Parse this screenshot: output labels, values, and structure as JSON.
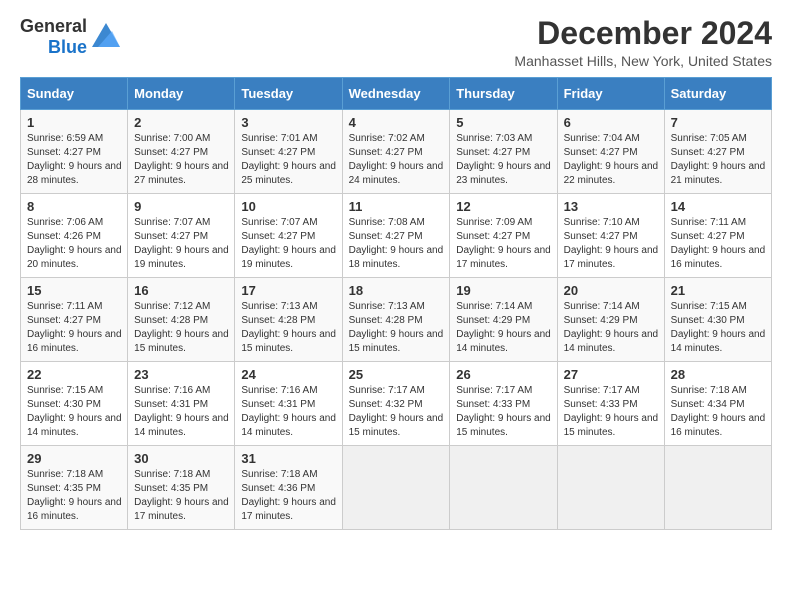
{
  "header": {
    "logo_general": "General",
    "logo_blue": "Blue",
    "month_title": "December 2024",
    "location": "Manhasset Hills, New York, United States"
  },
  "weekdays": [
    "Sunday",
    "Monday",
    "Tuesday",
    "Wednesday",
    "Thursday",
    "Friday",
    "Saturday"
  ],
  "weeks": [
    [
      {
        "day": "1",
        "sunrise": "6:59 AM",
        "sunset": "4:27 PM",
        "daylight": "9 hours and 28 minutes."
      },
      {
        "day": "2",
        "sunrise": "7:00 AM",
        "sunset": "4:27 PM",
        "daylight": "9 hours and 27 minutes."
      },
      {
        "day": "3",
        "sunrise": "7:01 AM",
        "sunset": "4:27 PM",
        "daylight": "9 hours and 25 minutes."
      },
      {
        "day": "4",
        "sunrise": "7:02 AM",
        "sunset": "4:27 PM",
        "daylight": "9 hours and 24 minutes."
      },
      {
        "day": "5",
        "sunrise": "7:03 AM",
        "sunset": "4:27 PM",
        "daylight": "9 hours and 23 minutes."
      },
      {
        "day": "6",
        "sunrise": "7:04 AM",
        "sunset": "4:27 PM",
        "daylight": "9 hours and 22 minutes."
      },
      {
        "day": "7",
        "sunrise": "7:05 AM",
        "sunset": "4:27 PM",
        "daylight": "9 hours and 21 minutes."
      }
    ],
    [
      {
        "day": "8",
        "sunrise": "7:06 AM",
        "sunset": "4:26 PM",
        "daylight": "9 hours and 20 minutes."
      },
      {
        "day": "9",
        "sunrise": "7:07 AM",
        "sunset": "4:27 PM",
        "daylight": "9 hours and 19 minutes."
      },
      {
        "day": "10",
        "sunrise": "7:07 AM",
        "sunset": "4:27 PM",
        "daylight": "9 hours and 19 minutes."
      },
      {
        "day": "11",
        "sunrise": "7:08 AM",
        "sunset": "4:27 PM",
        "daylight": "9 hours and 18 minutes."
      },
      {
        "day": "12",
        "sunrise": "7:09 AM",
        "sunset": "4:27 PM",
        "daylight": "9 hours and 17 minutes."
      },
      {
        "day": "13",
        "sunrise": "7:10 AM",
        "sunset": "4:27 PM",
        "daylight": "9 hours and 17 minutes."
      },
      {
        "day": "14",
        "sunrise": "7:11 AM",
        "sunset": "4:27 PM",
        "daylight": "9 hours and 16 minutes."
      }
    ],
    [
      {
        "day": "15",
        "sunrise": "7:11 AM",
        "sunset": "4:27 PM",
        "daylight": "9 hours and 16 minutes."
      },
      {
        "day": "16",
        "sunrise": "7:12 AM",
        "sunset": "4:28 PM",
        "daylight": "9 hours and 15 minutes."
      },
      {
        "day": "17",
        "sunrise": "7:13 AM",
        "sunset": "4:28 PM",
        "daylight": "9 hours and 15 minutes."
      },
      {
        "day": "18",
        "sunrise": "7:13 AM",
        "sunset": "4:28 PM",
        "daylight": "9 hours and 15 minutes."
      },
      {
        "day": "19",
        "sunrise": "7:14 AM",
        "sunset": "4:29 PM",
        "daylight": "9 hours and 14 minutes."
      },
      {
        "day": "20",
        "sunrise": "7:14 AM",
        "sunset": "4:29 PM",
        "daylight": "9 hours and 14 minutes."
      },
      {
        "day": "21",
        "sunrise": "7:15 AM",
        "sunset": "4:30 PM",
        "daylight": "9 hours and 14 minutes."
      }
    ],
    [
      {
        "day": "22",
        "sunrise": "7:15 AM",
        "sunset": "4:30 PM",
        "daylight": "9 hours and 14 minutes."
      },
      {
        "day": "23",
        "sunrise": "7:16 AM",
        "sunset": "4:31 PM",
        "daylight": "9 hours and 14 minutes."
      },
      {
        "day": "24",
        "sunrise": "7:16 AM",
        "sunset": "4:31 PM",
        "daylight": "9 hours and 14 minutes."
      },
      {
        "day": "25",
        "sunrise": "7:17 AM",
        "sunset": "4:32 PM",
        "daylight": "9 hours and 15 minutes."
      },
      {
        "day": "26",
        "sunrise": "7:17 AM",
        "sunset": "4:33 PM",
        "daylight": "9 hours and 15 minutes."
      },
      {
        "day": "27",
        "sunrise": "7:17 AM",
        "sunset": "4:33 PM",
        "daylight": "9 hours and 15 minutes."
      },
      {
        "day": "28",
        "sunrise": "7:18 AM",
        "sunset": "4:34 PM",
        "daylight": "9 hours and 16 minutes."
      }
    ],
    [
      {
        "day": "29",
        "sunrise": "7:18 AM",
        "sunset": "4:35 PM",
        "daylight": "9 hours and 16 minutes."
      },
      {
        "day": "30",
        "sunrise": "7:18 AM",
        "sunset": "4:35 PM",
        "daylight": "9 hours and 17 minutes."
      },
      {
        "day": "31",
        "sunrise": "7:18 AM",
        "sunset": "4:36 PM",
        "daylight": "9 hours and 17 minutes."
      },
      null,
      null,
      null,
      null
    ]
  ]
}
